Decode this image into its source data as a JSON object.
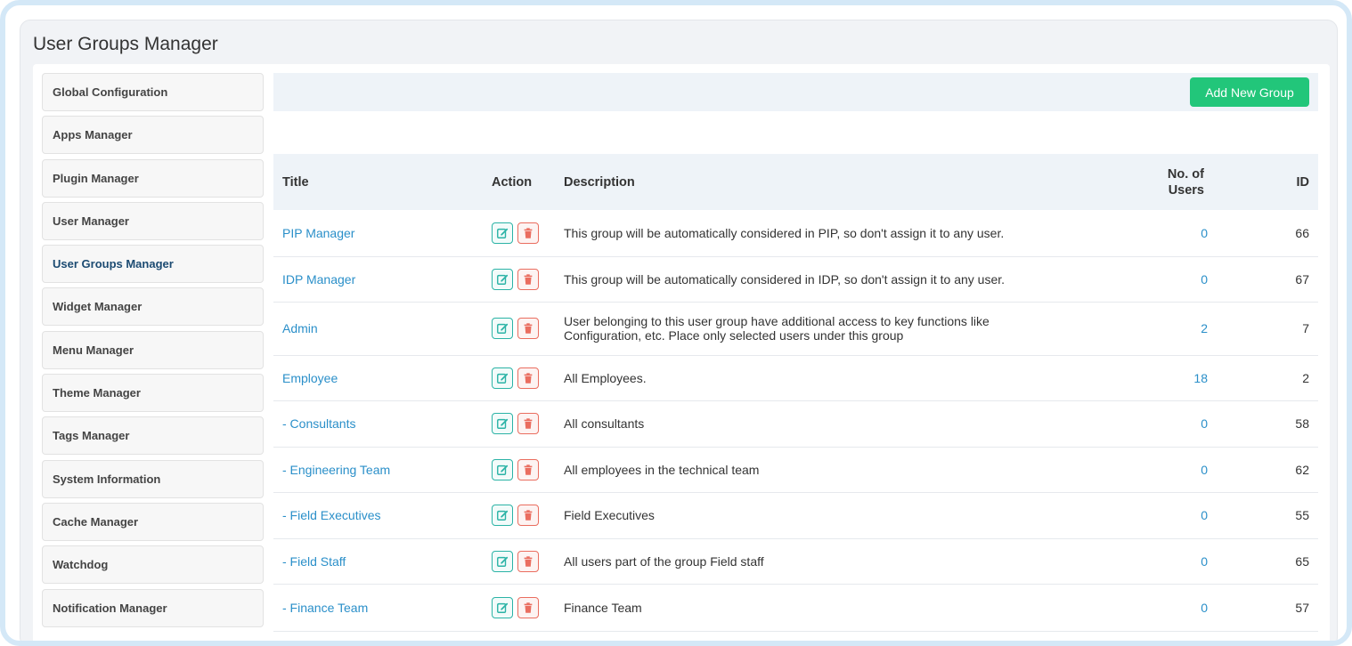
{
  "page": {
    "title": "User Groups Manager"
  },
  "sidebar": {
    "items": [
      {
        "label": "Global Configuration",
        "active": false
      },
      {
        "label": "Apps Manager",
        "active": false
      },
      {
        "label": "Plugin Manager",
        "active": false
      },
      {
        "label": "User Manager",
        "active": false
      },
      {
        "label": "User Groups Manager",
        "active": true
      },
      {
        "label": "Widget Manager",
        "active": false
      },
      {
        "label": "Menu Manager",
        "active": false
      },
      {
        "label": "Theme Manager",
        "active": false
      },
      {
        "label": "Tags Manager",
        "active": false
      },
      {
        "label": "System Information",
        "active": false
      },
      {
        "label": "Cache Manager",
        "active": false
      },
      {
        "label": "Watchdog",
        "active": false
      },
      {
        "label": "Notification Manager",
        "active": false
      }
    ]
  },
  "toolbar": {
    "add_label": "Add New Group"
  },
  "table": {
    "headers": {
      "title": "Title",
      "action": "Action",
      "description": "Description",
      "users_line1": "No. of",
      "users_line2": "Users",
      "id": "ID"
    },
    "rows": [
      {
        "title": "PIP Manager",
        "description": "This group will be automatically considered in PIP, so don't assign it to any user.",
        "users": "0",
        "id": "66"
      },
      {
        "title": "IDP Manager",
        "description": "This group will be automatically considered in IDP, so don't assign it to any user.",
        "users": "0",
        "id": "67"
      },
      {
        "title": "Admin",
        "description": "User belonging to this user group have additional access to key functions like Configuration, etc. Place only selected users under this group",
        "users": "2",
        "id": "7"
      },
      {
        "title": "Employee",
        "description": "All Employees.",
        "users": "18",
        "id": "2"
      },
      {
        "title": "- Consultants",
        "description": "All consultants",
        "users": "0",
        "id": "58"
      },
      {
        "title": "- Engineering Team",
        "description": "All employees in the technical team",
        "users": "0",
        "id": "62"
      },
      {
        "title": "- Field Executives",
        "description": "Field Executives",
        "users": "0",
        "id": "55"
      },
      {
        "title": "- Field Staff",
        "description": "All users part of the group Field staff",
        "users": "0",
        "id": "65"
      },
      {
        "title": "- Finance Team",
        "description": "Finance Team",
        "users": "0",
        "id": "57"
      }
    ]
  },
  "colors": {
    "accent_green": "#22c67a",
    "link_blue": "#2a8fc9",
    "edit_teal": "#2bb3a6",
    "delete_red": "#ea6d5f"
  },
  "icons": {
    "edit": "edit-icon",
    "delete": "trash-icon"
  }
}
